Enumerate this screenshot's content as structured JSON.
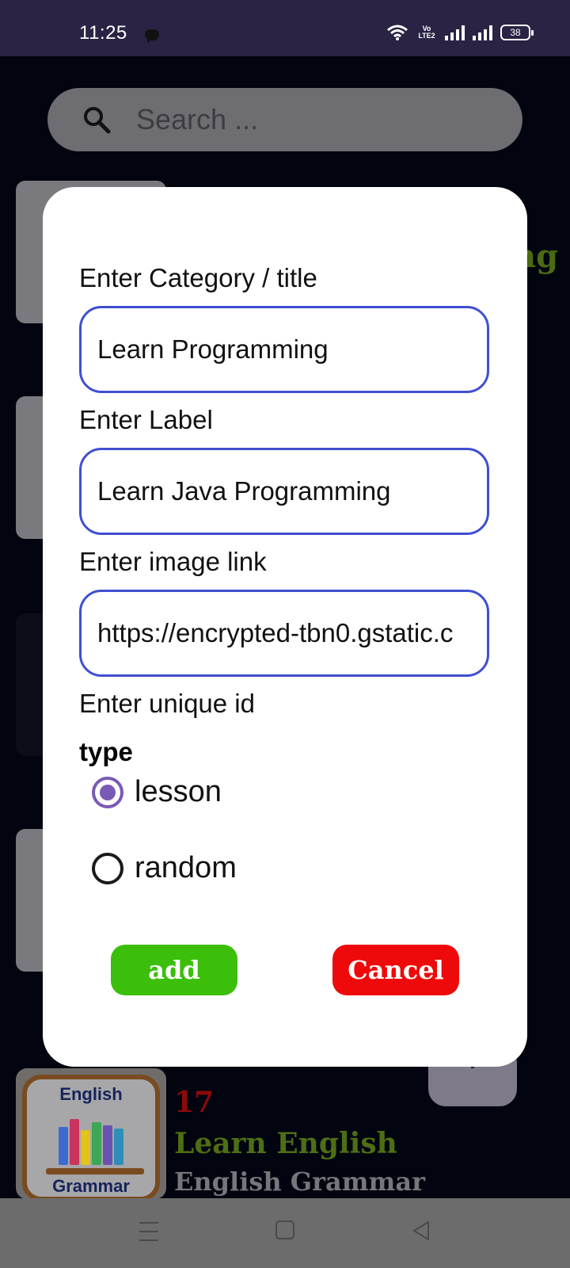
{
  "status_bar": {
    "time": "11:25",
    "battery": "38",
    "volte_line1": "Vo",
    "volte_line2": "LTE2",
    "icons": [
      "chat-icon",
      "wifi-icon",
      "volte-icon",
      "signal-icon",
      "signal-icon",
      "battery-icon"
    ]
  },
  "background": {
    "search": {
      "placeholder": "Search ...",
      "icon": "search-icon"
    },
    "peek_text": "ng",
    "list_item": {
      "number": "17",
      "title": "Learn English",
      "subtitle": "English Grammar",
      "thumb_top": "English",
      "thumb_bottom": "Grammar"
    }
  },
  "dialog": {
    "category_label": "Enter Category / title",
    "category_value": "Learn Programming",
    "label_label": "Enter Label",
    "label_value": "Learn Java Programming",
    "image_label": "Enter image link",
    "image_value": "https://encrypted-tbn0.gstatic.c",
    "id_label": "Enter unique id",
    "type_label": "type",
    "options": [
      {
        "label": "lesson",
        "selected": true
      },
      {
        "label": "random",
        "selected": false
      }
    ],
    "add_label": "add",
    "cancel_label": "Cancel"
  },
  "colors": {
    "accent_input_border": "#3f4fd0",
    "radio_selected": "#7a5ab5",
    "add_button": "#3bbf0a",
    "cancel_button": "#ee0a0a"
  },
  "nav_bar": {
    "icons": [
      "menu-icon",
      "home-icon",
      "back-icon"
    ]
  }
}
